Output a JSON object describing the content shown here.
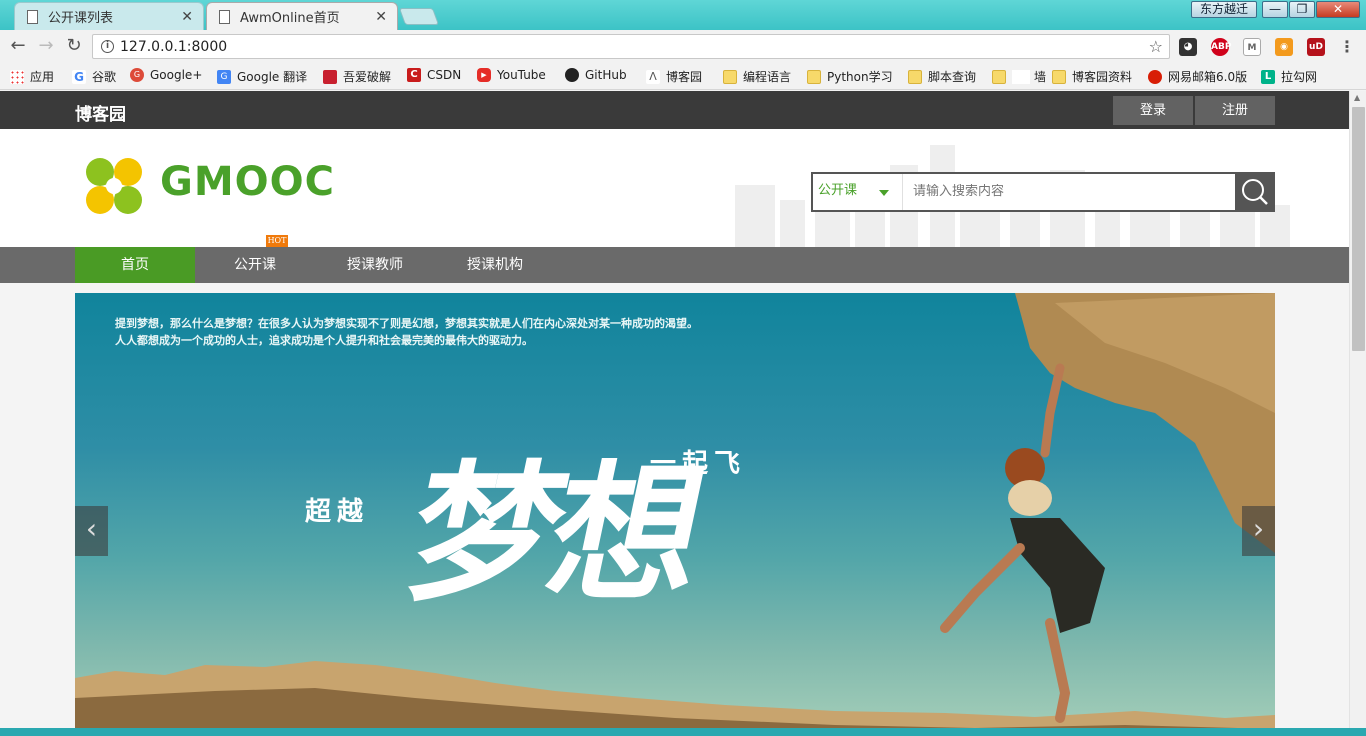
{
  "browser": {
    "tabs": [
      {
        "title": "公开课列表",
        "close": "✕"
      },
      {
        "title": "AwmOnline首页",
        "close": "✕"
      }
    ],
    "user_button": "东方越迁",
    "window_controls": {
      "min": "—",
      "max": "❐",
      "close": "✕"
    },
    "url": "127.0.0.1:8000",
    "info_glyph": "i",
    "star_glyph": "☆",
    "nav": {
      "back": "←",
      "forward": "→",
      "reload": "↻"
    },
    "bookmarks": [
      {
        "label": "应用",
        "icon": "apps-grid-icon"
      },
      {
        "label": "谷歌",
        "icon": "google-icon"
      },
      {
        "label": "Google+",
        "icon": "google-plus-icon"
      },
      {
        "label": "Google 翻译",
        "icon": "google-translate-icon"
      },
      {
        "label": "吾爱破解",
        "icon": "52pojie-icon"
      },
      {
        "label": "CSDN",
        "icon": "csdn-icon"
      },
      {
        "label": "YouTube",
        "icon": "youtube-icon"
      },
      {
        "label": "GitHub",
        "icon": "github-icon"
      },
      {
        "label": "博客园",
        "icon": "cnblogs-icon"
      },
      {
        "label": "编程语言",
        "icon": "folder-icon"
      },
      {
        "label": "Python学习",
        "icon": "folder-icon"
      },
      {
        "label": "脚本查询",
        "icon": "folder-icon"
      },
      {
        "label": "墙",
        "icon": "folder-icon"
      },
      {
        "label": "博客园资料",
        "icon": "folder-icon"
      },
      {
        "label": "网易邮箱6.0版",
        "icon": "netease-icon"
      },
      {
        "label": "拉勾网",
        "icon": "lagou-icon"
      }
    ],
    "extensions": [
      "ABP",
      "M",
      "RSS",
      "uD"
    ]
  },
  "site": {
    "brand": "博客园",
    "login": "登录",
    "register": "注册",
    "logo_text": "GMOOC",
    "search": {
      "category": "公开课",
      "placeholder": "请输入搜索内容"
    },
    "hot_badge": "HOT",
    "nav": [
      {
        "label": "首页",
        "active": true
      },
      {
        "label": "公开课",
        "active": false
      },
      {
        "label": "授课教师",
        "active": false
      },
      {
        "label": "授课机构",
        "active": false
      }
    ],
    "banner": {
      "intro_line1": "提到梦想，那么什么是梦想？在很多人认为梦想实现不了则是幻想，梦想其实就是人们在内心深处对某一种成功的渴望。",
      "intro_line2": "人人都想成为一个成功的人士，追求成功是个人提升和社会最完美的最伟大的驱动力。",
      "headline_prefix": "超越",
      "headline_main": "梦想",
      "headline_suffix": "一起飞",
      "prev": "‹",
      "next": "›"
    }
  },
  "colors": {
    "accent_green": "#4a9b25",
    "topbar": "#3a3a3a",
    "navbar": "#6a6a6a",
    "hot": "#f07a0b"
  }
}
